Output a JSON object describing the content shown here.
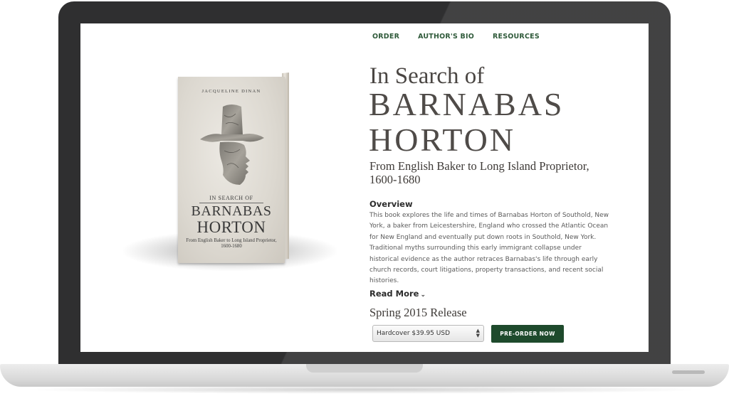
{
  "nav": {
    "items": [
      {
        "label": "ORDER"
      },
      {
        "label": "AUTHOR'S BIO"
      },
      {
        "label": "RESOURCES"
      }
    ]
  },
  "book_cover": {
    "author": "JACQUELINE DINAN",
    "title_line1": "IN SEARCH OF",
    "title_line2": "BARNABAS",
    "title_line3": "HORTON",
    "subtitle": "From English Baker to Long Island Proprietor,",
    "years": "1600-1680"
  },
  "hero": {
    "title_line1": "In Search of",
    "title_line2": "BARNABAS",
    "title_line3": "HORTON",
    "subtitle": "From English Baker to Long Island Proprietor, 1600-1680"
  },
  "overview": {
    "heading": "Overview",
    "body": "This book explores the life and times of Barnabas Horton of Southold, New York, a baker from Leicestershire, England who crossed the Atlantic Ocean for New England and eventually put down roots in Southold, New York. Traditional myths surrounding this early immigrant collapse under historical evidence as the author retraces Barnabas's life through early church records, court litigations, property transactions, and recent social histories.",
    "read_more": "Read More"
  },
  "purchase": {
    "release": "Spring 2015 Release",
    "format_selected": "Hardcover $39.95 USD",
    "button": "PRE-ORDER NOW"
  },
  "colors": {
    "accent": "#1e4a2c",
    "nav": "#2f5a3a",
    "frame": "#2f2f30"
  }
}
